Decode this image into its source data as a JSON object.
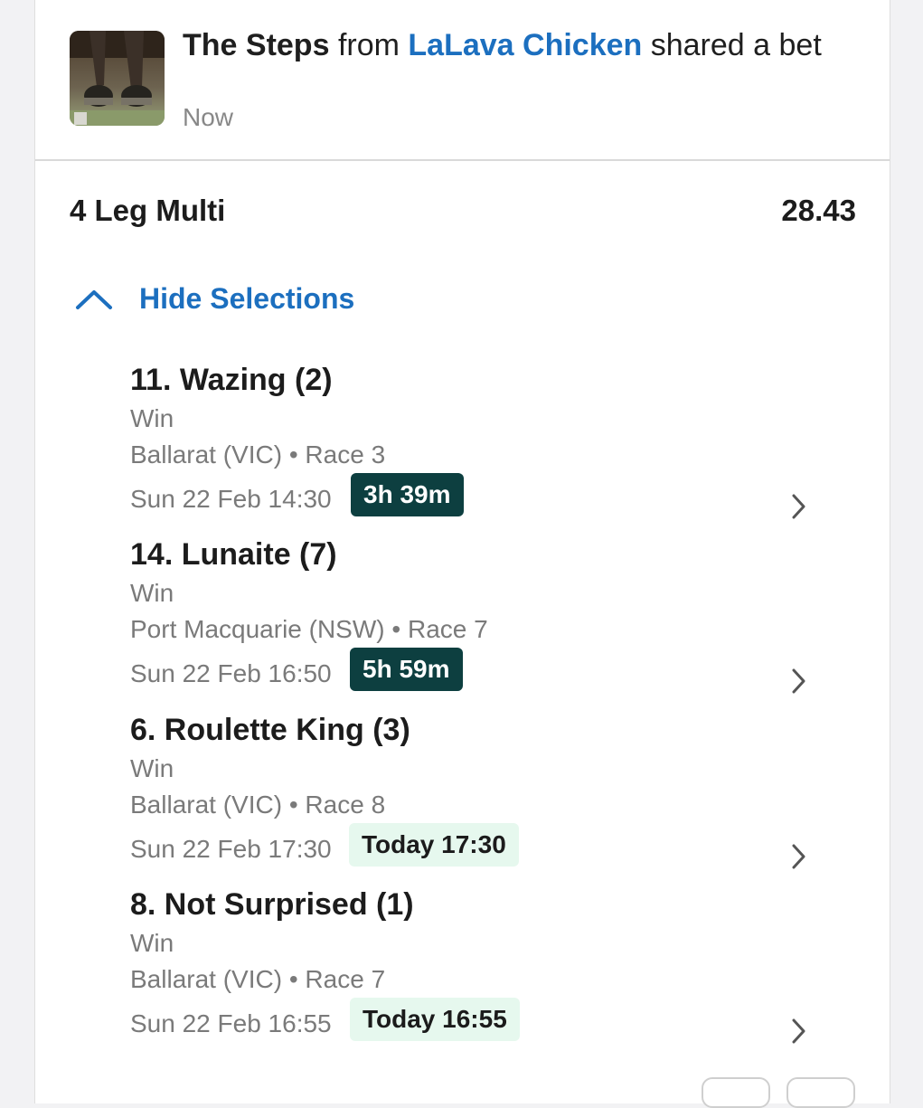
{
  "header": {
    "user": "The Steps",
    "from_word": "from",
    "group": "LaLava Chicken",
    "action": "shared a bet",
    "time": "Now"
  },
  "bet": {
    "type": "4 Leg Multi",
    "odds": "28.43",
    "toggle_label": "Hide Selections"
  },
  "selections": [
    {
      "name": "11. Wazing (2)",
      "bet_type": "Win",
      "venue": "Ballarat (VIC)",
      "race": "Race 3",
      "date": "Sun 22 Feb 14:30",
      "badge": "3h 39m",
      "badge_style": "dark"
    },
    {
      "name": "14. Lunaite (7)",
      "bet_type": "Win",
      "venue": "Port Macquarie (NSW)",
      "race": "Race 7",
      "date": "Sun 22 Feb 16:50",
      "badge": "5h 59m",
      "badge_style": "dark"
    },
    {
      "name": "6. Roulette King (3)",
      "bet_type": "Win",
      "venue": "Ballarat (VIC)",
      "race": "Race 8",
      "date": "Sun 22 Feb 17:30",
      "badge": "Today 17:30",
      "badge_style": "light"
    },
    {
      "name": "8. Not Surprised (1)",
      "bet_type": "Win",
      "venue": "Ballarat (VIC)",
      "race": "Race 7",
      "date": "Sun 22 Feb 16:55",
      "badge": "Today 16:55",
      "badge_style": "light"
    }
  ],
  "colors": {
    "link": "#1c6fbf",
    "badge_dark": "#0d3f40",
    "badge_light": "#e6f8ee",
    "muted_text": "#7a7a7a"
  },
  "icons": [
    "horse-hooves-avatar",
    "chevron-up-icon",
    "chevron-right-icon"
  ]
}
